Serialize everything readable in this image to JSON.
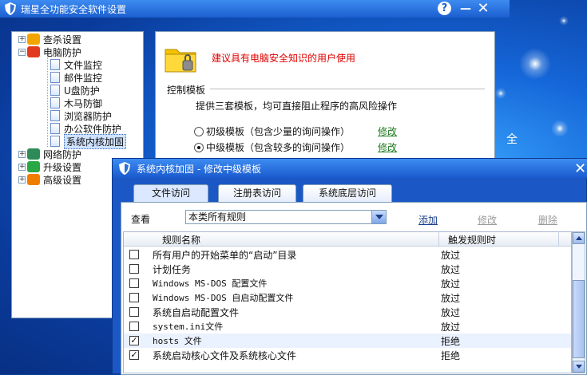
{
  "main_window": {
    "title": "瑞星全功能安全软件设置",
    "help": "?",
    "minimize": "—",
    "close": "✕",
    "deco_text": "全"
  },
  "tree": [
    {
      "label": "查杀设置",
      "expander": "+",
      "icon": "magnifier-icon",
      "color": "#f2a400"
    },
    {
      "label": "电脑防护",
      "expander": "−",
      "icon": "shield-computer-icon",
      "color": "#e23a1e"
    },
    {
      "label": "文件监控"
    },
    {
      "label": "邮件监控"
    },
    {
      "label": "U盘防护"
    },
    {
      "label": "木马防御"
    },
    {
      "label": "浏览器防护"
    },
    {
      "label": "办公软件防护"
    },
    {
      "label": "系统内核加固",
      "selected": true
    },
    {
      "label": "网络防护",
      "expander": "+",
      "icon": "network-icon",
      "color": "#2e8b57"
    },
    {
      "label": "升级设置",
      "expander": "+",
      "icon": "update-icon",
      "color": "#2aa845"
    },
    {
      "label": "高级设置",
      "expander": "+",
      "icon": "gear-icon",
      "color": "#f07d00"
    }
  ],
  "content": {
    "warning": "建议具有电脑安全知识的用户使用",
    "section_title": "控制模板",
    "description": "提供三套模板，均可直接阻止程序的高风险操作",
    "options": [
      {
        "label": "初级模板（包含少量的询问操作）",
        "checked": false,
        "action": "修改"
      },
      {
        "label": "中级模板（包含较多的询问操作）",
        "checked": true,
        "action": "修改"
      }
    ]
  },
  "dialog": {
    "title": "系统内核加固 - 修改中级模板",
    "close": "✕",
    "tabs": [
      "文件访问",
      "注册表访问",
      "系统底层访问"
    ],
    "view_label": "查看",
    "filter_value": "本类所有规则",
    "actions": {
      "add": "添加",
      "edit": "修改",
      "delete": "删除"
    },
    "columns": {
      "name": "规则名称",
      "trigger": "触发规则时"
    },
    "rows": [
      {
        "name": "所有用户的开始菜单的“启动”目录",
        "trigger": "放过",
        "checked": false
      },
      {
        "name": "计划任务",
        "trigger": "放过",
        "checked": false
      },
      {
        "name": "Windows MS-DOS 配置文件",
        "trigger": "放过",
        "checked": false
      },
      {
        "name": "Windows MS-DOS 自启动配置文件",
        "trigger": "放过",
        "checked": false
      },
      {
        "name": "系统自启动配置文件",
        "trigger": "放过",
        "checked": false
      },
      {
        "name": "system.ini文件",
        "trigger": "放过",
        "checked": false
      },
      {
        "name": "hosts 文件",
        "trigger": "拒绝",
        "checked": true
      },
      {
        "name": "系统启动核心文件及系统核心文件",
        "trigger": "拒绝",
        "checked": true
      }
    ]
  }
}
